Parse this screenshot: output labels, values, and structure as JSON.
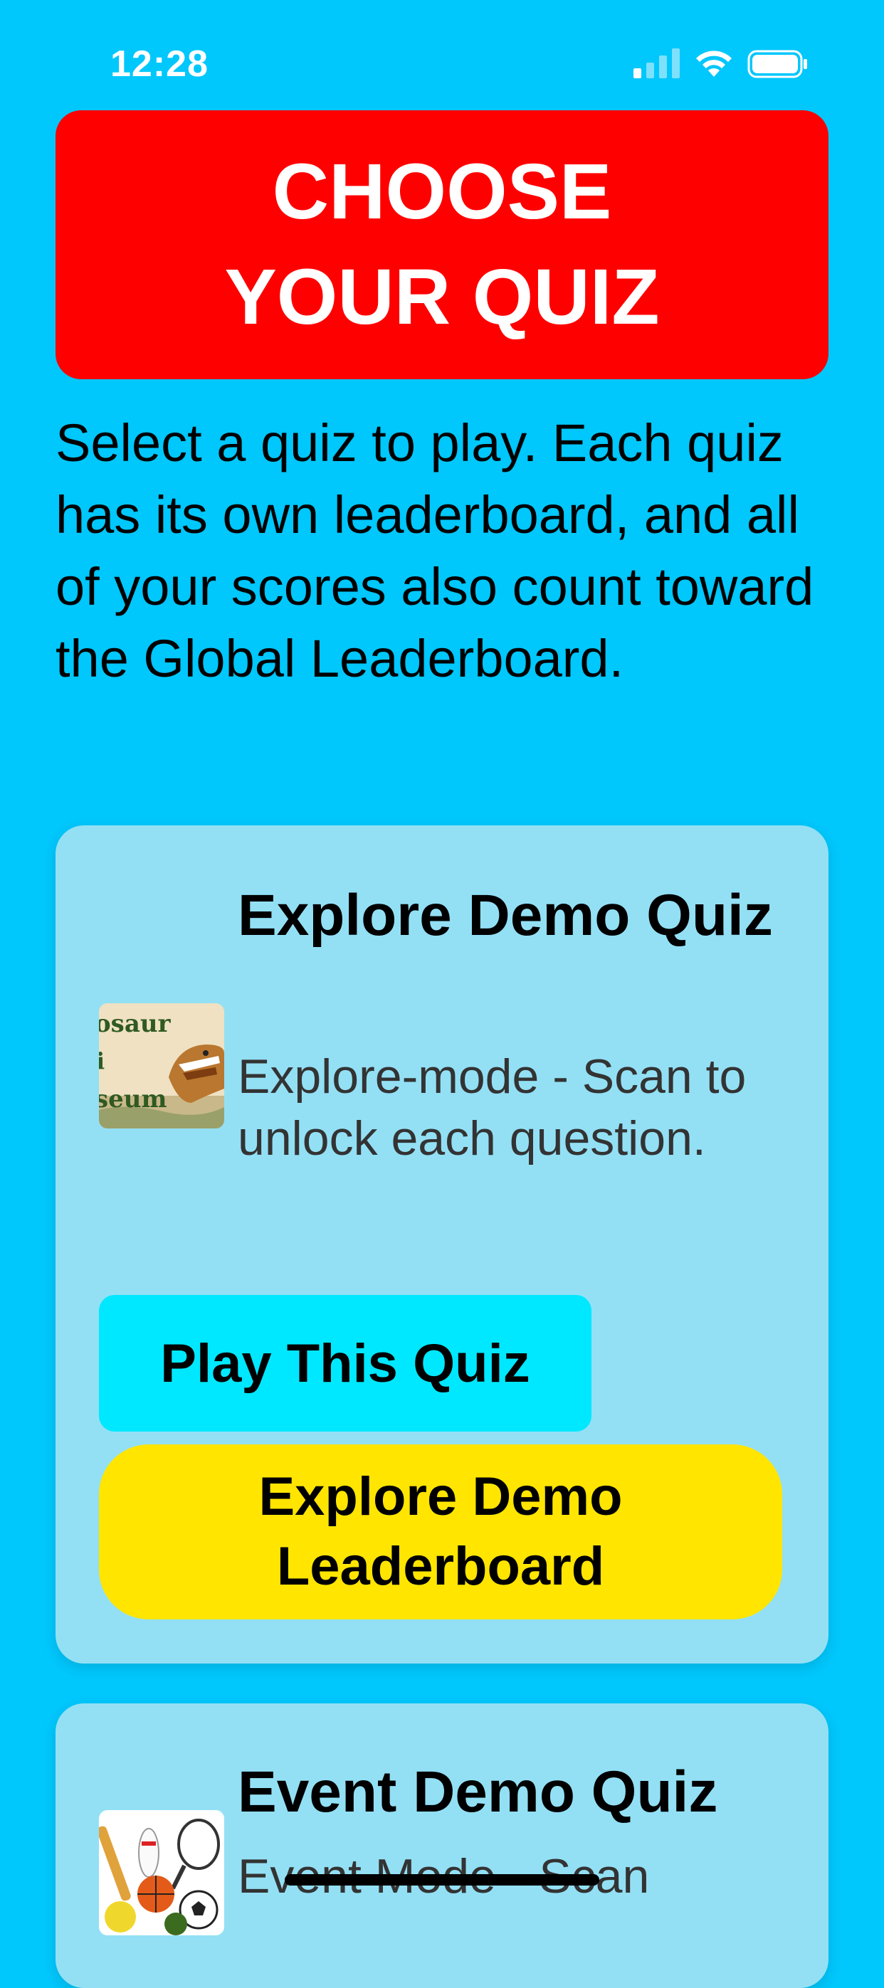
{
  "status_bar": {
    "time": "12:28"
  },
  "header": {
    "title": "CHOOSE YOUR QUIZ"
  },
  "intro": {
    "text": "Select a quiz to play. Each quiz has its own leaderboard, and all of your scores also count toward the Global Leaderboard."
  },
  "quizzes": [
    {
      "title": "Explore Demo Quiz",
      "description": "Explore-mode - Scan to unlock each question.",
      "thumbnail_icon": "dinosaur-museum-thumbnail",
      "thumbnail_text": [
        "osaur",
        "i",
        "seum"
      ],
      "play_label": "Play This Quiz",
      "leaderboard_label": "Explore Demo Leaderboard"
    },
    {
      "title": "Event Demo Quiz",
      "description": "Event Mode - Scan",
      "thumbnail_icon": "sports-equipment-thumbnail"
    }
  ],
  "colors": {
    "background": "#00c7fc",
    "header": "#ff0000",
    "card": "#93e0f5",
    "play_button": "#00e8ff",
    "leaderboard_button": "#ffe500"
  }
}
